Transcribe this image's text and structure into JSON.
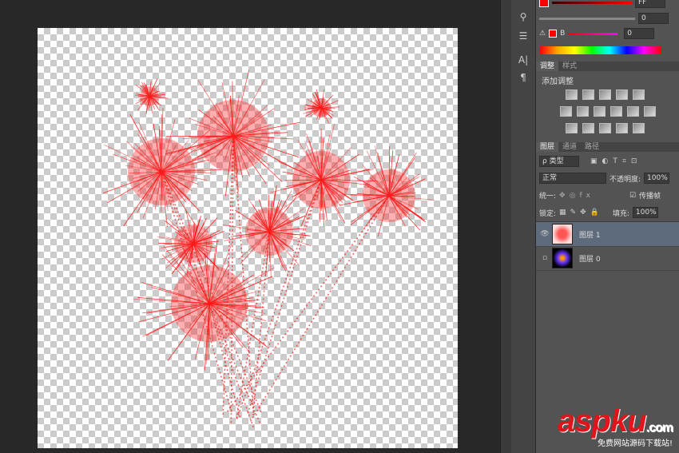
{
  "color_panel": {
    "r_value": "FF",
    "g_value": "0",
    "b_label": "B",
    "b_value": "0"
  },
  "adjustments": {
    "tabs": [
      "调整",
      "样式"
    ],
    "title": "添加调整"
  },
  "layers": {
    "tabs": [
      "图层",
      "通道",
      "路径"
    ],
    "filter_type": "ρ 类型",
    "blend_mode": "正常",
    "opacity_label": "不透明度:",
    "opacity_value": "100%",
    "unify_label": "统一:",
    "propagate_label": "传播帧",
    "lock_label": "锁定:",
    "fill_label": "填充:",
    "fill_value": "100%",
    "items": [
      {
        "name": "图层 1",
        "visible": true,
        "selected": true
      },
      {
        "name": "图层 0",
        "visible": false,
        "selected": false
      }
    ]
  },
  "watermark": {
    "logo": "aspku",
    "tld": ".com",
    "subtitle": "免费网站源码下载站!"
  },
  "colors": {
    "firework": "#ff1a1a",
    "panel": "#535353",
    "selection": "#5e6b7c"
  }
}
